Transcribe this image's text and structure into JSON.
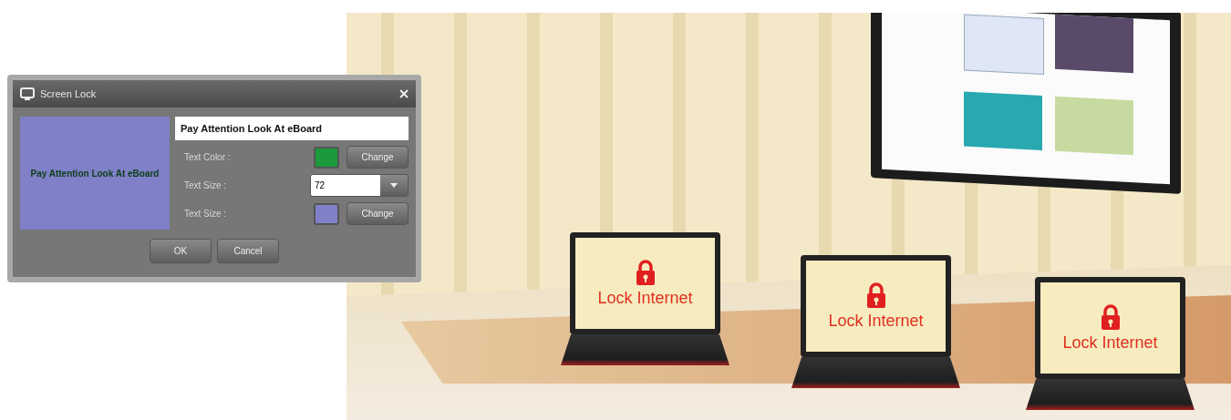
{
  "dialog": {
    "title": "Screen Lock",
    "preview_text": "Pay Attention Look At eBoard",
    "message_input": "Pay Attention Look At eBoard",
    "rows": [
      {
        "kind": "color",
        "label": "Text Color :",
        "color": "#1a9a3a",
        "button": "Change"
      },
      {
        "kind": "select",
        "label": "Text Size :",
        "value": "72"
      },
      {
        "kind": "color",
        "label": "Text Size :",
        "color": "#8080c8",
        "button": "Change"
      }
    ],
    "buttons": [
      "OK",
      "Cancel"
    ]
  },
  "illustration": {
    "laptops": [
      {
        "label": "Lock Internet"
      },
      {
        "label": "Lock Internet"
      },
      {
        "label": "Lock Internet"
      }
    ]
  }
}
